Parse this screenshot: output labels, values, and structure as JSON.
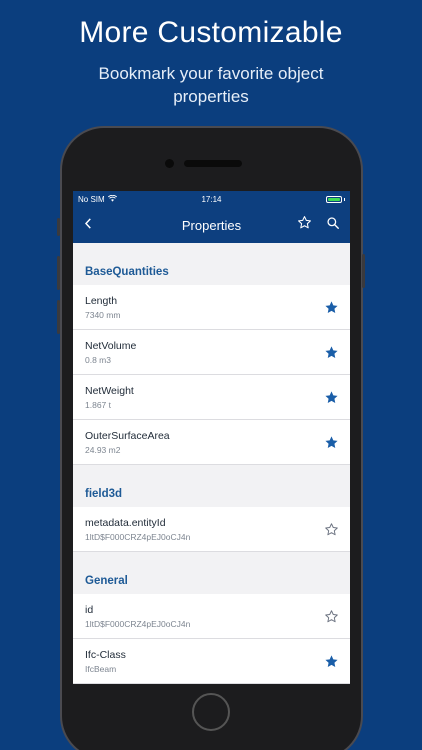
{
  "promo": {
    "headline": "More Customizable",
    "subline": "Bookmark your favorite object properties"
  },
  "status_bar": {
    "carrier": "No SIM",
    "time": "17:14"
  },
  "nav": {
    "title": "Properties",
    "icons": [
      "back-chevron-icon",
      "star-outline-icon",
      "search-icon"
    ]
  },
  "colors": {
    "background": "#0b3e7e",
    "nav_bar": "#0d3f7f",
    "section_header": "#1e5a96",
    "star_filled": "#1a5ea8"
  },
  "sections": [
    {
      "title": "BaseQuantities",
      "rows": [
        {
          "name": "Length",
          "value": "7340 mm",
          "bookmarked": true
        },
        {
          "name": "NetVolume",
          "value": "0.8 m3",
          "bookmarked": true
        },
        {
          "name": "NetWeight",
          "value": "1.867 t",
          "bookmarked": true
        },
        {
          "name": "OuterSurfaceArea",
          "value": "24.93 m2",
          "bookmarked": true
        }
      ]
    },
    {
      "title": "field3d",
      "rows": [
        {
          "name": "metadata.entityId",
          "value": "1ltD$F000CRZ4pEJ0oCJ4n",
          "bookmarked": false
        }
      ]
    },
    {
      "title": "General",
      "rows": [
        {
          "name": "id",
          "value": "1ltD$F000CRZ4pEJ0oCJ4n",
          "bookmarked": false
        },
        {
          "name": "Ifc-Class",
          "value": "IfcBeam",
          "bookmarked": true
        }
      ]
    }
  ]
}
